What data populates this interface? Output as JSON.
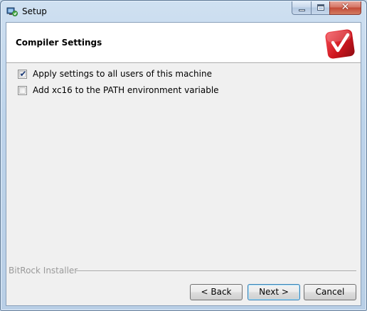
{
  "window": {
    "title": "Setup",
    "icon": "setup-app-icon",
    "controls": {
      "minimize": "minimize-icon",
      "maximize": "maximize-icon",
      "close": "close-icon",
      "close_glyph": "✕"
    }
  },
  "header": {
    "title": "Compiler Settings",
    "logo": "installer-brand-logo"
  },
  "options": [
    {
      "label": "Apply settings to all users of this machine",
      "checked": true
    },
    {
      "label": "Add xc16 to the PATH environment variable",
      "checked": false
    }
  ],
  "footer": {
    "brand": "BitRock Installer"
  },
  "buttons": {
    "back": "< Back",
    "next": "Next >",
    "cancel": "Cancel"
  },
  "colors": {
    "accent": "#3c7fb1",
    "close_button": "#c44a37",
    "logo_red": "#d0161e"
  }
}
